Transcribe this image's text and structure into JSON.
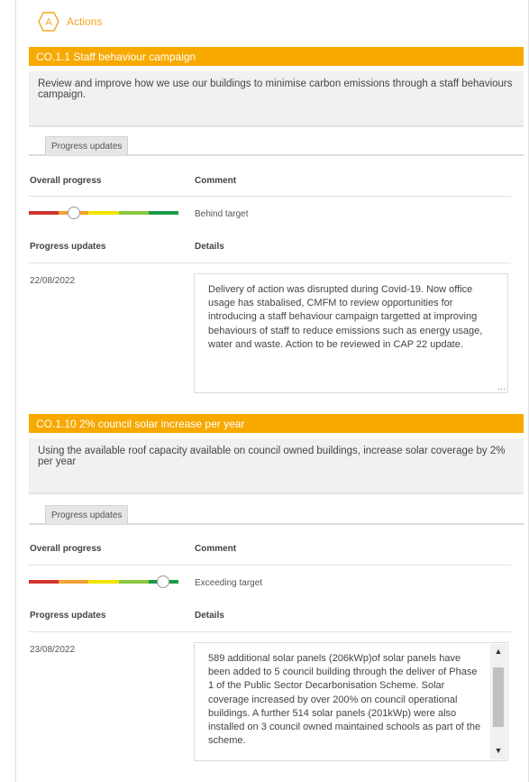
{
  "header": {
    "icon_letter": "A",
    "title": "Actions"
  },
  "colors": {
    "accent": "#f7a900",
    "red": "#d1342f",
    "orange": "#f2a030",
    "yellow": "#f3e500",
    "lightgreen": "#8dc63f",
    "green": "#1a9b49"
  },
  "actions": [
    {
      "title": "CO.1.1 Staff behaviour campaign",
      "description": "Review and improve how we use our buildings to minimise carbon emissions through a staff behaviours campaign.",
      "tab": "Progress updates",
      "overall_progress_label": "Overall progress",
      "comment_label": "Comment",
      "progress_level": 0.3,
      "comment": "Behind target",
      "progress_updates_label": "Progress updates",
      "details_label": "Details",
      "date": "22/08/2022",
      "details": "Delivery of action was disrupted during Covid-19. Now office usage has stabalised, CMFM to review opportunities for introducing a staff behaviour campaign targetted at improving behaviours of staff to reduce emissions such as energy usage, water and waste. Action to be reviewed in CAP 22 update."
    },
    {
      "title": "CO.1.10 2% council solar increase per year",
      "description": "Using the available roof capacity available on council owned buildings, increase solar coverage by 2% per year",
      "tab": "Progress updates",
      "overall_progress_label": "Overall progress",
      "comment_label": "Comment",
      "progress_level": 0.9,
      "comment": "Exceeding target",
      "progress_updates_label": "Progress updates",
      "details_label": "Details",
      "date": "23/08/2022",
      "details": "589 additional solar panels (206kWp)of solar panels have been added to 5 council building through the deliver of Phase 1 of the Public Sector Decarbonisation Scheme. Solar coverage increased by over 200% on council operational buildings. A further 514 solar panels (201kWp) were also installed on 3 council owned maintained schools as part of the scheme."
    }
  ]
}
